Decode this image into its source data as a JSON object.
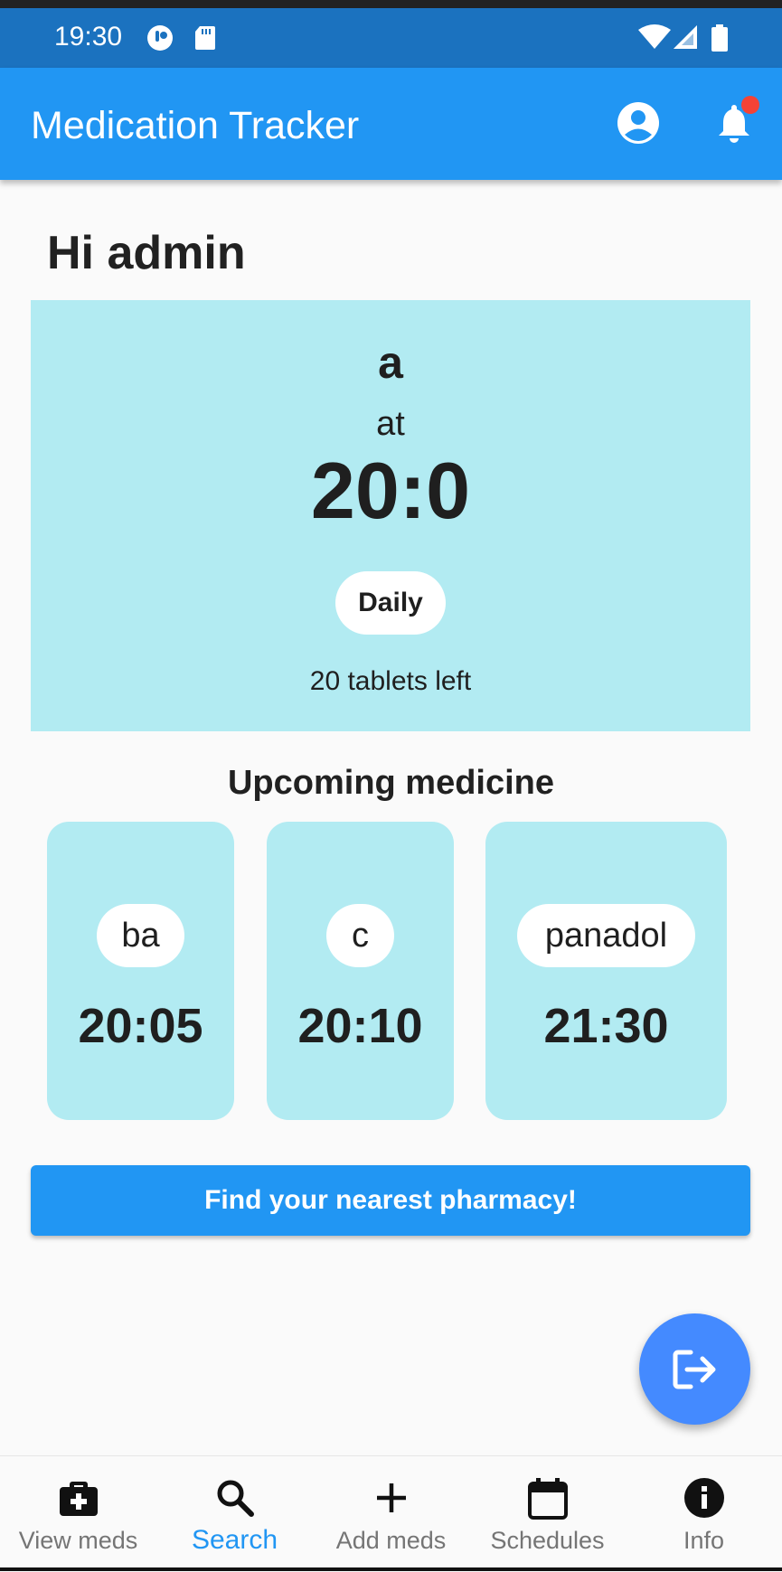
{
  "status_bar": {
    "time": "19:30"
  },
  "app_bar": {
    "title": "Medication Tracker"
  },
  "greeting": "Hi admin",
  "current_med": {
    "name": "a",
    "at_label": "at",
    "time": "20:0",
    "frequency": "Daily",
    "remaining": "20 tablets left"
  },
  "upcoming": {
    "title": "Upcoming medicine",
    "items": [
      {
        "name": "ba",
        "time": "20:05"
      },
      {
        "name": "c",
        "time": "20:10"
      },
      {
        "name": "panadol",
        "time": "21:30"
      }
    ]
  },
  "pharmacy_button": "Find your nearest pharmacy!",
  "bottom_nav": {
    "items": [
      {
        "label": "View meds",
        "icon": "medical-bag-icon"
      },
      {
        "label": "Search",
        "icon": "search-icon",
        "active": true
      },
      {
        "label": "Add meds",
        "icon": "plus-icon"
      },
      {
        "label": "Schedules",
        "icon": "calendar-icon"
      },
      {
        "label": "Info",
        "icon": "info-icon"
      }
    ]
  },
  "colors": {
    "primary": "#2196f3",
    "status_bar": "#1b72bf",
    "card": "#b2ebf2",
    "fab": "#448aff",
    "notification": "#f44336"
  }
}
